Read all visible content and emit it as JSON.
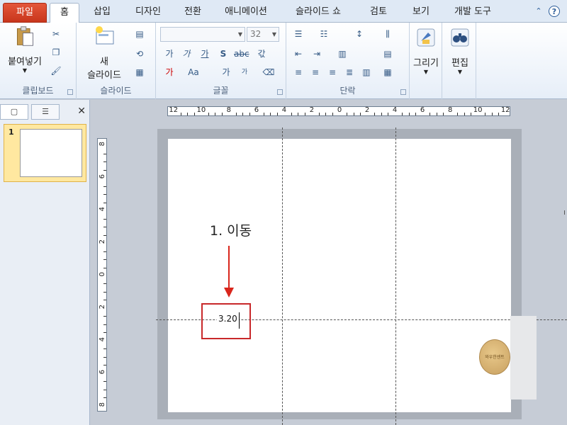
{
  "tabs": [
    "파일",
    "홈",
    "삽입",
    "디자인",
    "전환",
    "애니메이션",
    "슬라이드 쇼",
    "검토",
    "보기",
    "개발 도구"
  ],
  "ribbon": {
    "clipboard": {
      "label": "클립보드",
      "paste": "붙여넣기"
    },
    "slides": {
      "label": "슬라이드",
      "new_line1": "새",
      "new_line2": "슬라이드"
    },
    "font": {
      "label": "글꼴",
      "font_name": "",
      "font_size": "32"
    },
    "paragraph": {
      "label": "단락"
    },
    "drawing": {
      "label": "그리기"
    },
    "editing": {
      "label": "편집"
    }
  },
  "panel": {
    "slide_number": "1"
  },
  "ruler": {
    "h_labels": [
      "12",
      "10",
      "8",
      "6",
      "4",
      "2",
      "0",
      "2",
      "4",
      "6",
      "8",
      "10",
      "12"
    ],
    "v_labels": [
      "8",
      "6",
      "4",
      "2",
      "0",
      "2",
      "4",
      "6",
      "8"
    ]
  },
  "canvas": {
    "annotation": "1. 이동",
    "coord_readout": "3.20",
    "stamp_text": "와우한센트"
  },
  "colors": {
    "accent_red": "#c8282a",
    "file_tab": "#d14524",
    "selection": "#ffe8a0"
  }
}
